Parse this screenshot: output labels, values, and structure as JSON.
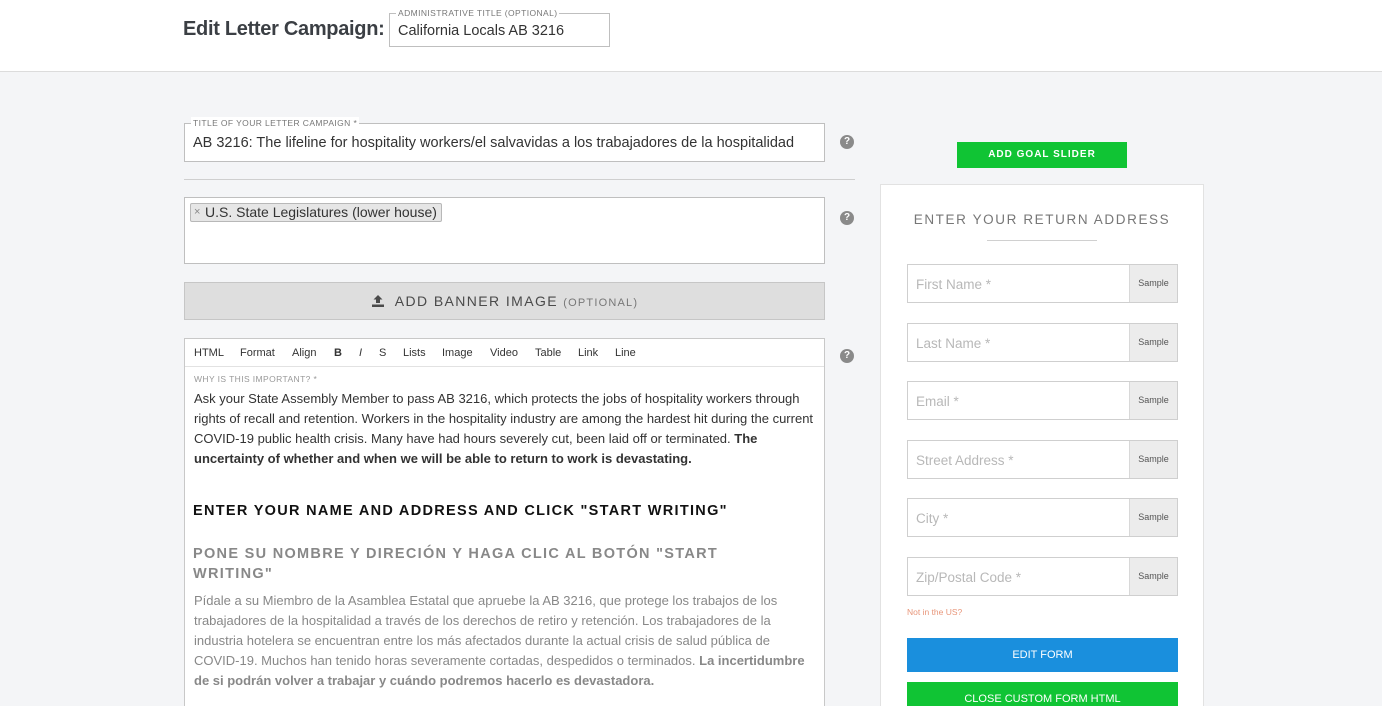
{
  "header": {
    "title": "Edit Letter Campaign:",
    "admin_title_label": "ADMINISTRATIVE TITLE (OPTIONAL)",
    "admin_title_value": "California Locals AB 3216"
  },
  "campaign": {
    "title_label": "TITLE OF YOUR LETTER CAMPAIGN *",
    "title_value": "AB 3216: The lifeline for hospitality workers/el salvavidas a los trabajadores de la hospitalidad",
    "target_tag": "U.S. State Legislatures (lower house)",
    "tag_remove": "×",
    "banner_label": "ADD BANNER IMAGE",
    "banner_optional": "(OPTIONAL)",
    "help": "?"
  },
  "editor": {
    "toolbar": [
      "HTML",
      "Format",
      "Align",
      "B",
      "I",
      "S",
      "Lists",
      "Image",
      "Video",
      "Table",
      "Link",
      "Line"
    ],
    "label": "WHY IS THIS IMPORTANT? *",
    "para_en": "Ask your State Assembly Member to pass AB 3216, which protects the jobs of hospitality workers through rights of recall and retention. Workers in the hospitality industry are among the hardest hit during the current COVID-19 public health crisis. Many have had hours severely cut, been laid off or terminated.",
    "para_en_bold": "The uncertainty of whether and when we will be able to return to work is devastating.",
    "heading_en": "ENTER YOUR NAME AND ADDRESS AND CLICK \"START WRITING\"",
    "heading_es": "PONE SU NOMBRE Y DIRECIÓN Y HAGA CLIC AL BOTÓN \"START WRITING\"",
    "para_es": "Pídale a su Miembro de la Asamblea Estatal que apruebe la AB 3216, que protege los trabajos de los trabajadores de la hospitalidad a través de los derechos de retiro y retención. Los trabajadores de la industria hotelera se encuentran entre los más afectados durante la actual crisis de salud pública de COVID-19. Muchos han tenido horas severamente cortadas, despedidos o terminados.",
    "para_es_bold": "La incertidumbre de si podrán volver a trabajar y cuándo podremos hacerlo es devastadora."
  },
  "sidebar": {
    "goal_button": "ADD GOAL SLIDER",
    "panel_title": "ENTER YOUR RETURN ADDRESS",
    "fields": [
      {
        "placeholder": "First Name *",
        "sample": "Sample"
      },
      {
        "placeholder": "Last Name *",
        "sample": "Sample"
      },
      {
        "placeholder": "Email *",
        "sample": "Sample"
      },
      {
        "placeholder": "Street Address *",
        "sample": "Sample"
      },
      {
        "placeholder": "City *",
        "sample": "Sample"
      },
      {
        "placeholder": "Zip/Postal Code *",
        "sample": "Sample"
      }
    ],
    "not_us": "Not in the US?",
    "edit_form": "EDIT FORM",
    "close_html": "CLOSE CUSTOM FORM HTML"
  },
  "colors": {
    "green": "#10c434",
    "blue": "#1a8fdd"
  }
}
